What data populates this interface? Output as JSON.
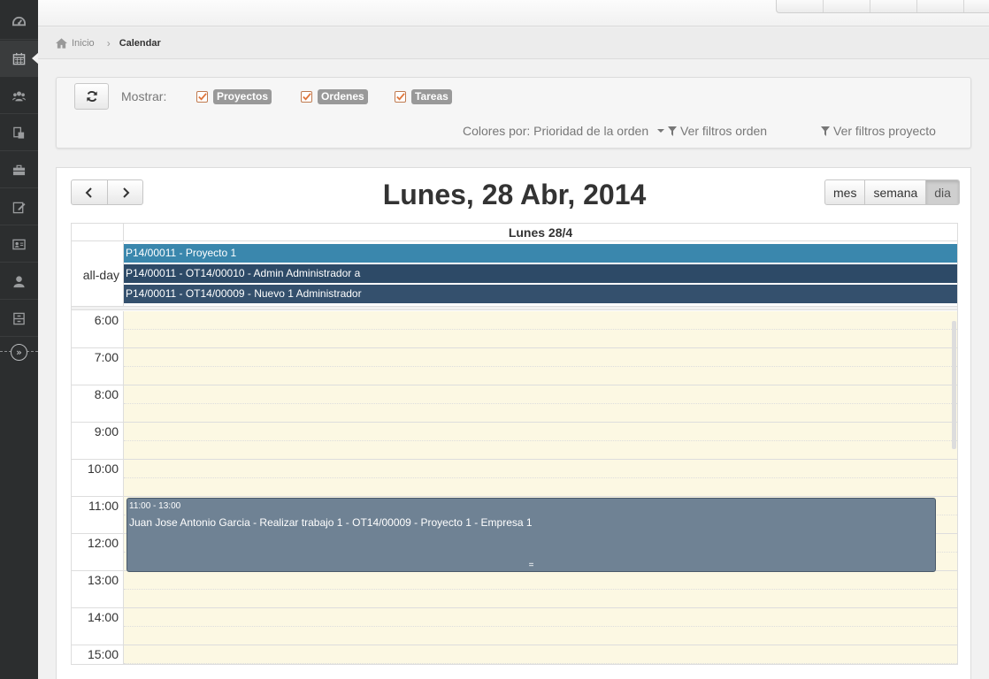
{
  "sidebar": {
    "items": [
      {
        "icon": "dashboard-icon"
      },
      {
        "icon": "calendar-icon"
      },
      {
        "icon": "users-icon"
      },
      {
        "icon": "documents-icon"
      },
      {
        "icon": "briefcase-icon"
      },
      {
        "icon": "edit-icon"
      },
      {
        "icon": "contact-card-icon"
      },
      {
        "icon": "user-icon"
      },
      {
        "icon": "cabinet-icon"
      }
    ],
    "collapse_icon": "double-chevron-right-icon"
  },
  "breadcrumb": {
    "home": "Inicio",
    "current": "Calendar"
  },
  "filters": {
    "mostrar_label": "Mostrar:",
    "checks": [
      {
        "label": "Proyectos",
        "checked": true
      },
      {
        "label": "Ordenes",
        "checked": true
      },
      {
        "label": "Tareas",
        "checked": true
      }
    ],
    "colores_label": "Colores por: Prioridad de la orden",
    "ver_filtros_orden": "Ver filtros orden",
    "ver_filtros_proyecto": "Ver filtros proyecto",
    "accent": "#e0763b"
  },
  "calendar": {
    "title": "Lunes, 28 Abr, 2014",
    "views": [
      "mes",
      "semana",
      "dia"
    ],
    "active_view": "dia",
    "day_header": "Lunes 28/4",
    "allday_label": "all-day",
    "allday_events": [
      {
        "title": "P14/00011 - Proyecto 1",
        "color": "#3a87ad"
      },
      {
        "title": "P14/00011 - OT14/00010 - Admin Administrador a",
        "color": "#2d4a67"
      },
      {
        "title": "P14/00011 - OT14/00009 - Nuevo 1 Administrador",
        "color": "#34506d"
      }
    ],
    "hours": [
      "6:00",
      "7:00",
      "8:00",
      "9:00",
      "10:00",
      "11:00",
      "12:00",
      "13:00",
      "14:00",
      "15:00"
    ],
    "event": {
      "time": "11:00 - 13:00",
      "title": "Juan Jose Antonio Garcia - Realizar trabajo 1 - OT14/00009 - Proyecto 1 - Empresa 1",
      "resize_glyph": "=",
      "color": "#6f8294"
    }
  }
}
